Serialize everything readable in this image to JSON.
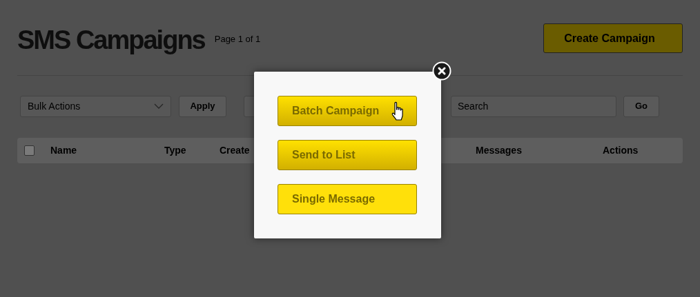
{
  "header": {
    "title": "SMS Campaigns",
    "page_info": "Page 1 of 1",
    "create_button": "Create Campaign"
  },
  "toolbar": {
    "bulk_actions": {
      "placeholder": "Bulk Actions"
    },
    "apply_button": "Apply",
    "search": {
      "placeholder": "Search"
    },
    "go_button": "Go"
  },
  "table": {
    "select_all_checked": false,
    "columns": [
      "Name",
      "Type",
      "Create",
      "Messages",
      "Actions"
    ]
  },
  "modal": {
    "buttons": [
      {
        "label": "Batch Campaign",
        "kind": "gradient",
        "hovered": true
      },
      {
        "label": "Send to List",
        "kind": "gradient",
        "hovered": false
      },
      {
        "label": "Single Message",
        "kind": "flat",
        "hovered": false
      }
    ]
  }
}
